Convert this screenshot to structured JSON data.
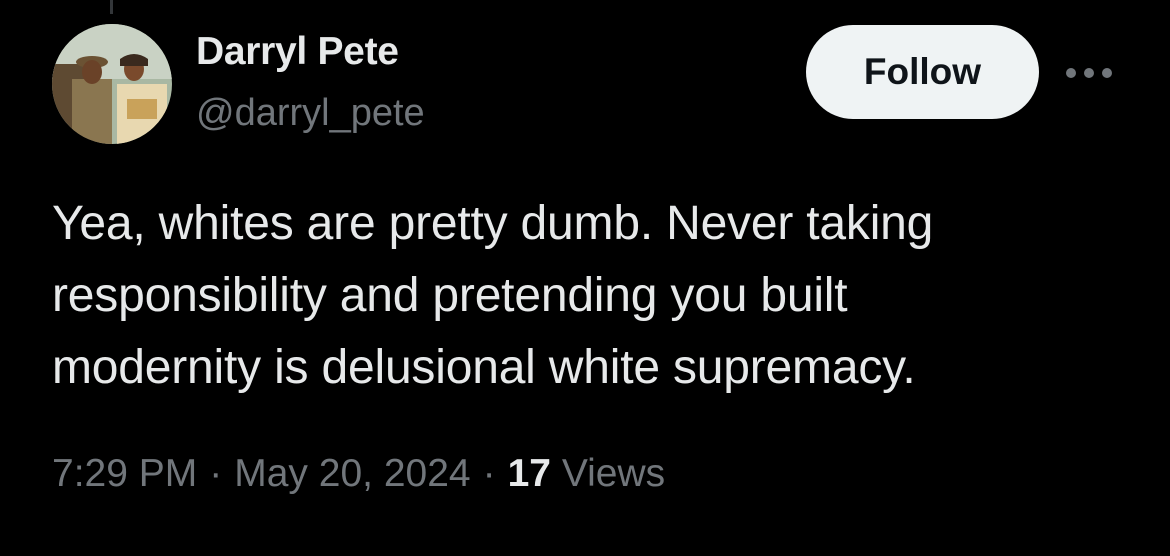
{
  "author": {
    "display_name": "Darryl Pete",
    "handle": "@darryl_pete",
    "avatar_icon": "profile-photo"
  },
  "actions": {
    "follow_label": "Follow",
    "more_icon": "more-horizontal-icon"
  },
  "tweet": {
    "lines": [
      "Yea, whites are pretty dumb. Never taking",
      "responsibility and pretending you built",
      "modernity is delusional white supremacy."
    ]
  },
  "meta": {
    "time": "7:29 PM",
    "separator": "·",
    "date": "May 20, 2024",
    "views_count": "17",
    "views_label": "Views"
  },
  "colors": {
    "background": "#000000",
    "primary_text": "#e7e9ea",
    "secondary_text": "#71767b",
    "follow_bg": "#eff3f4",
    "follow_text": "#0f1419"
  }
}
